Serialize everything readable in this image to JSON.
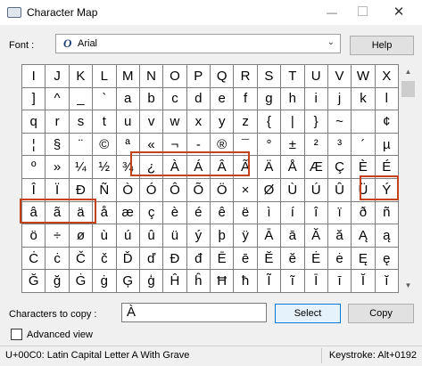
{
  "window": {
    "title": "Character Map",
    "min_glyph": "—",
    "close_glyph": "✕",
    "icon": "character-map-icon"
  },
  "font": {
    "label": "Font :",
    "value": "Arial",
    "icon_glyph": "O",
    "chevron": "⌄"
  },
  "buttons": {
    "help": "Help",
    "select": "Select",
    "copy": "Copy"
  },
  "characters": [
    "I",
    "J",
    "K",
    "L",
    "M",
    "N",
    "O",
    "P",
    "Q",
    "R",
    "S",
    "T",
    "U",
    "V",
    "W",
    "X",
    "]",
    "^",
    "_",
    "`",
    "a",
    "b",
    "c",
    "d",
    "e",
    "f",
    "g",
    "h",
    "i",
    "j",
    "k",
    "l",
    "q",
    "r",
    "s",
    "t",
    "u",
    "v",
    "w",
    "x",
    "y",
    "z",
    "{",
    "|",
    "}",
    "~",
    " ",
    "¢",
    "¦",
    "§",
    "¨",
    "©",
    "ª",
    "«",
    "¬",
    "-",
    "®",
    "¯",
    "°",
    "±",
    "²",
    "³",
    "´",
    "µ",
    "º",
    "»",
    "¼",
    "½",
    "¾",
    "¿",
    "À",
    "Á",
    "Â",
    "Ã",
    "Ä",
    "Å",
    "Æ",
    "Ç",
    "È",
    "É",
    "Î",
    "Ï",
    "Ð",
    "Ñ",
    "Ò",
    "Ó",
    "Ô",
    "Õ",
    "Ö",
    "×",
    "Ø",
    "Ù",
    "Ú",
    "Û",
    "Ü",
    "Ý",
    "â",
    "ã",
    "ä",
    "å",
    "æ",
    "ç",
    "è",
    "é",
    "ê",
    "ë",
    "ì",
    "í",
    "î",
    "ï",
    "ð",
    "ñ",
    "ö",
    "÷",
    "ø",
    "ù",
    "ú",
    "û",
    "ü",
    "ý",
    "þ",
    "ÿ",
    "Ā",
    "ā",
    "Ă",
    "ă",
    "Ą",
    "ą",
    "Ċ",
    "ċ",
    "Č",
    "č",
    "Ď",
    "ď",
    "Đ",
    "đ",
    "Ē",
    "ē",
    "Ĕ",
    "ĕ",
    "Ė",
    "ė",
    "Ę",
    "ę",
    "Ğ",
    "ğ",
    "Ġ",
    "ġ",
    "Ģ",
    "ģ",
    "Ĥ",
    "ĥ",
    "Ħ",
    "ħ",
    "Ĩ",
    "ĩ",
    "Ī",
    "ī",
    "Ĭ",
    "ĭ"
  ],
  "characters_to_copy": {
    "label": "Characters to copy :",
    "value": "À"
  },
  "advanced_view": {
    "label": "Advanced view",
    "checked": false
  },
  "status": {
    "text": "U+00C0: Latin Capital Letter A With Grave",
    "keystroke": "Keystroke: Alt+0192"
  },
  "highlight_color": "#c4421a",
  "scrollbar": {
    "up_glyph": "▲",
    "down_glyph": "▼"
  }
}
